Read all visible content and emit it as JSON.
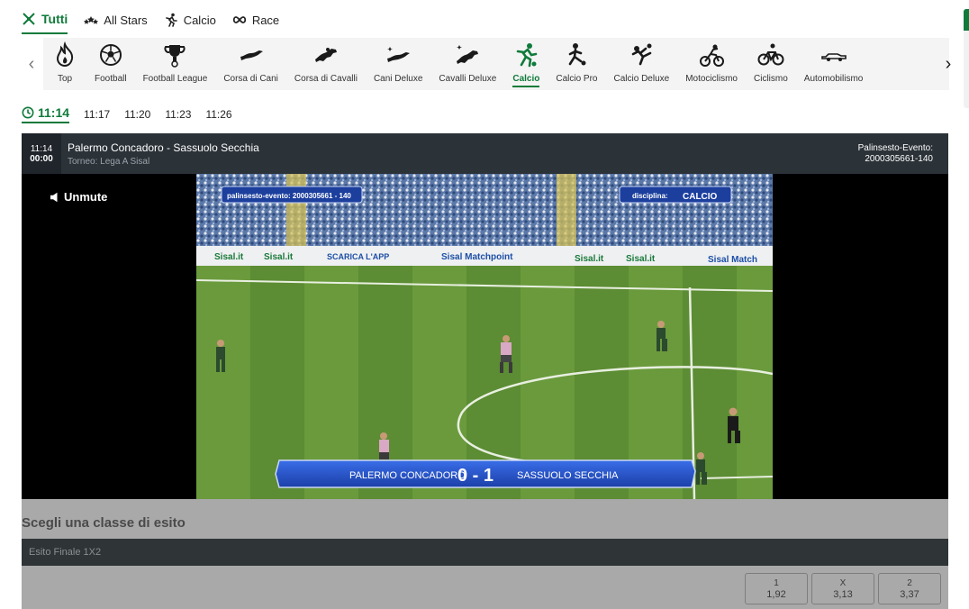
{
  "top_tabs": [
    {
      "label": "Tutti",
      "icon": "sword-cross-icon"
    },
    {
      "label": "All Stars",
      "icon": "stars-icon"
    },
    {
      "label": "Calcio",
      "icon": "runner-icon"
    },
    {
      "label": "Race",
      "icon": "infinity-icon"
    }
  ],
  "sports": [
    {
      "label": "Top",
      "icon": "flame-icon"
    },
    {
      "label": "Football",
      "icon": "soccer-ball-icon"
    },
    {
      "label": "Football League",
      "icon": "trophy-icon"
    },
    {
      "label": "Corsa di Cani",
      "icon": "greyhound-icon"
    },
    {
      "label": "Corsa di Cavalli",
      "icon": "horse-icon"
    },
    {
      "label": "Cani Deluxe",
      "icon": "greyhound-star-icon"
    },
    {
      "label": "Cavalli Deluxe",
      "icon": "horse-star-icon"
    },
    {
      "label": "Calcio",
      "icon": "soccer-player-icon"
    },
    {
      "label": "Calcio Pro",
      "icon": "soccer-kick-icon"
    },
    {
      "label": "Calcio Deluxe",
      "icon": "soccer-volley-icon"
    },
    {
      "label": "Motociclismo",
      "icon": "motorbike-icon"
    },
    {
      "label": "Ciclismo",
      "icon": "bicycle-icon"
    },
    {
      "label": "Automobilismo",
      "icon": "racecar-icon"
    }
  ],
  "times": [
    "11:14",
    "11:17",
    "11:20",
    "11:23",
    "11:26"
  ],
  "event": {
    "time": "11:14",
    "countdown": "00:00",
    "title": "Palermo Concadoro - Sassuolo Secchia",
    "subtitle": "Torneo: Lega A Sisal",
    "right_label": "Palinsesto-Evento:",
    "right_value": "2000305661-140"
  },
  "video": {
    "unmute_label": "Unmute",
    "overlay_event": "palinsesto-evento:  2000305661 - 140",
    "overlay_disc_label": "disciplina:",
    "overlay_disc_value": "CALCIO",
    "home_team": "PALERMO CONCADORO",
    "away_team": "SASSUOLO SECCHIA",
    "score": "0 - 1",
    "boards": [
      "Sisal.it",
      "Sisal.it",
      "SCARICA L'APP",
      "Sisal Matchpoint",
      "Sisal.it",
      "Sisal.it",
      "Sisal Match"
    ]
  },
  "market": {
    "title": "Scegli una classe di esito",
    "bar_label": "Esito Finale 1X2",
    "odds": [
      {
        "label": "1",
        "value": "1,92"
      },
      {
        "label": "X",
        "value": "3,13"
      },
      {
        "label": "2",
        "value": "3,37"
      }
    ]
  },
  "colors": {
    "accent": "#0f7a3a",
    "header": "#2b3238",
    "video_bg": "#000000"
  }
}
